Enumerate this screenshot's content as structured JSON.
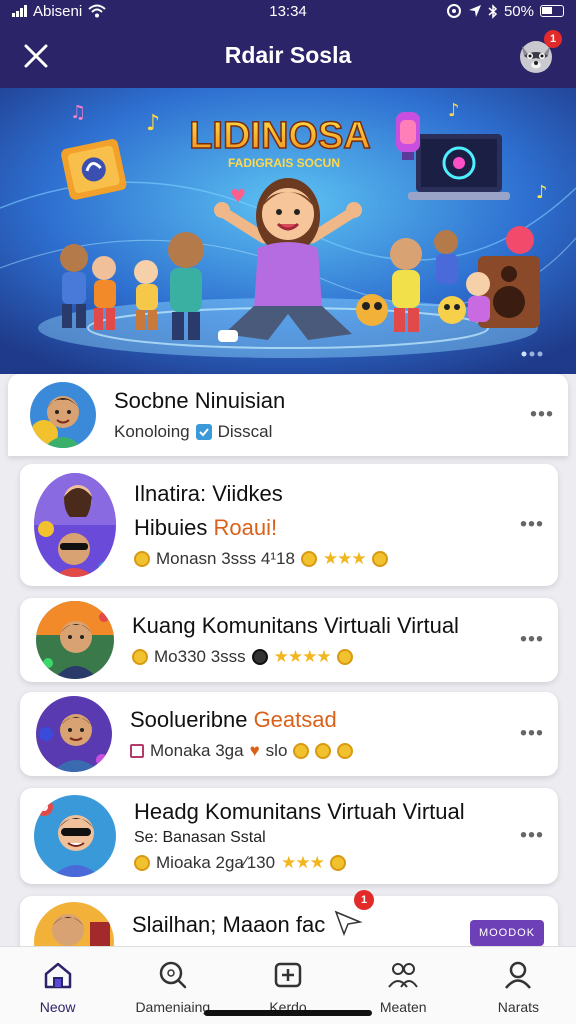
{
  "status_bar": {
    "carrier": "Abiseni",
    "time": "13:34",
    "battery": "50%"
  },
  "header": {
    "title": "Rdair Sosla",
    "notification_count": "1",
    "close_icon": "close-icon",
    "avatar_icon": "raccoon-avatar"
  },
  "banner": {
    "title": "LIDINOSA",
    "subtitle": "FADIGRAIS SOCUN"
  },
  "featured": {
    "title": "Socbne Ninuisian",
    "meta_left": "Konoloing",
    "meta_right": "Disscal"
  },
  "cards": [
    {
      "line1": "Ilnatira: Viidkes",
      "line2_prefix": "Hibuies",
      "line2_accent": "Roaui!",
      "meta": "Monasn 3sss 4¹18",
      "stars": "★★★"
    },
    {
      "line1": "Kuang Komunitans Virtuali Virtual",
      "meta": "Mo330 3sss",
      "stars": "★★★★"
    },
    {
      "line1_prefix": "Soolueribne",
      "line1_accent": "Geatsad",
      "meta": "Monaka 3ga",
      "meta2": "slo"
    },
    {
      "line1": "Headg Komunitans Virtuah Virtual",
      "line2": "Se: Banasan Sstal",
      "meta": "Mioaka 2ga∕130",
      "stars": "★★★"
    },
    {
      "line1": "Slailhan; Maaon fac",
      "notification_count": "1",
      "follow_label": "MOODOK"
    }
  ],
  "bottom_nav": [
    {
      "label": "Neow",
      "icon": "home-icon"
    },
    {
      "label": "Dameniaing",
      "icon": "search-icon"
    },
    {
      "label": "Kerdo",
      "icon": "add-icon"
    },
    {
      "label": "Meaten",
      "icon": "group-icon"
    },
    {
      "label": "Narats",
      "icon": "profile-icon"
    }
  ],
  "colors": {
    "header_bg": "#2c2468",
    "accent": "#d9611a",
    "follow_button": "#6e40b8",
    "badge": "#e22a2a"
  }
}
